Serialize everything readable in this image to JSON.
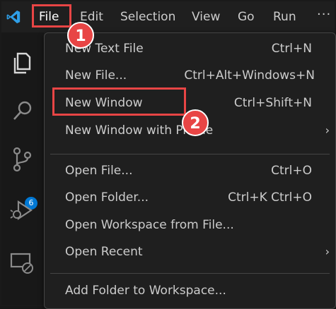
{
  "menubar": {
    "items": [
      "File",
      "Edit",
      "Selection",
      "View",
      "Go",
      "Run"
    ],
    "more": "···"
  },
  "activitybar": {
    "badge": "6"
  },
  "file_menu": {
    "items": [
      {
        "label": "New Text File",
        "shortcut": "Ctrl+N"
      },
      {
        "label": "New File...",
        "shortcut": "Ctrl+Alt+Windows+N"
      },
      {
        "label": "New Window",
        "shortcut": "Ctrl+Shift+N"
      },
      {
        "label": "New Window with Profile",
        "shortcut": ""
      },
      {
        "label": "Open File...",
        "shortcut": "Ctrl+O"
      },
      {
        "label": "Open Folder...",
        "shortcut": "Ctrl+K Ctrl+O"
      },
      {
        "label": "Open Workspace from File...",
        "shortcut": ""
      },
      {
        "label": "Open Recent",
        "shortcut": ""
      },
      {
        "label": "Add Folder to Workspace...",
        "shortcut": ""
      }
    ],
    "submenu_arrow": "›"
  },
  "annotations": {
    "step1": "1",
    "step2": "2"
  },
  "colors": {
    "accent": "#0078d4",
    "highlight": "#e84545",
    "menu_bg": "#1f1f1f",
    "text": "#cccccc"
  }
}
